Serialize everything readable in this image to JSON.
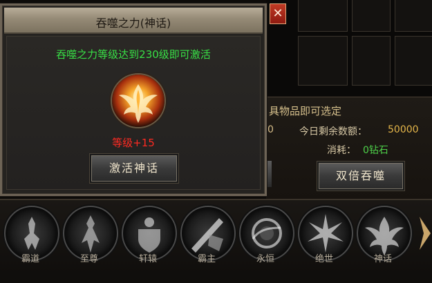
{
  "modal": {
    "title": "吞噬之力(神话)",
    "requirement": "吞噬之力等级达到230级即可激活",
    "level_bonus": "等级+15",
    "activate_button": "激活神话",
    "close_symbol": "✕"
  },
  "right_panel": {
    "title_partial": "具物品即可选定",
    "left_value_partial": "0",
    "remaining_label": "今日剩余数额：",
    "remaining_value": "50000",
    "cost_label": "消耗：",
    "cost_value": "0钻石",
    "double_button": "双倍吞噬"
  },
  "skills": [
    {
      "label": "霸道",
      "icon": "figure-icon"
    },
    {
      "label": "至尊",
      "icon": "warrior-icon"
    },
    {
      "label": "轩辕",
      "icon": "shield-icon"
    },
    {
      "label": "霸主",
      "icon": "blade-icon"
    },
    {
      "label": "永恒",
      "icon": "orb-icon"
    },
    {
      "label": "绝世",
      "icon": "burst-icon"
    },
    {
      "label": "神话",
      "icon": "phoenix-icon"
    }
  ],
  "colors": {
    "requirement_text": "#38e046",
    "level_text": "#ff2a22",
    "remaining_value": "#e6b74a",
    "cost_value": "#4ed24a"
  }
}
